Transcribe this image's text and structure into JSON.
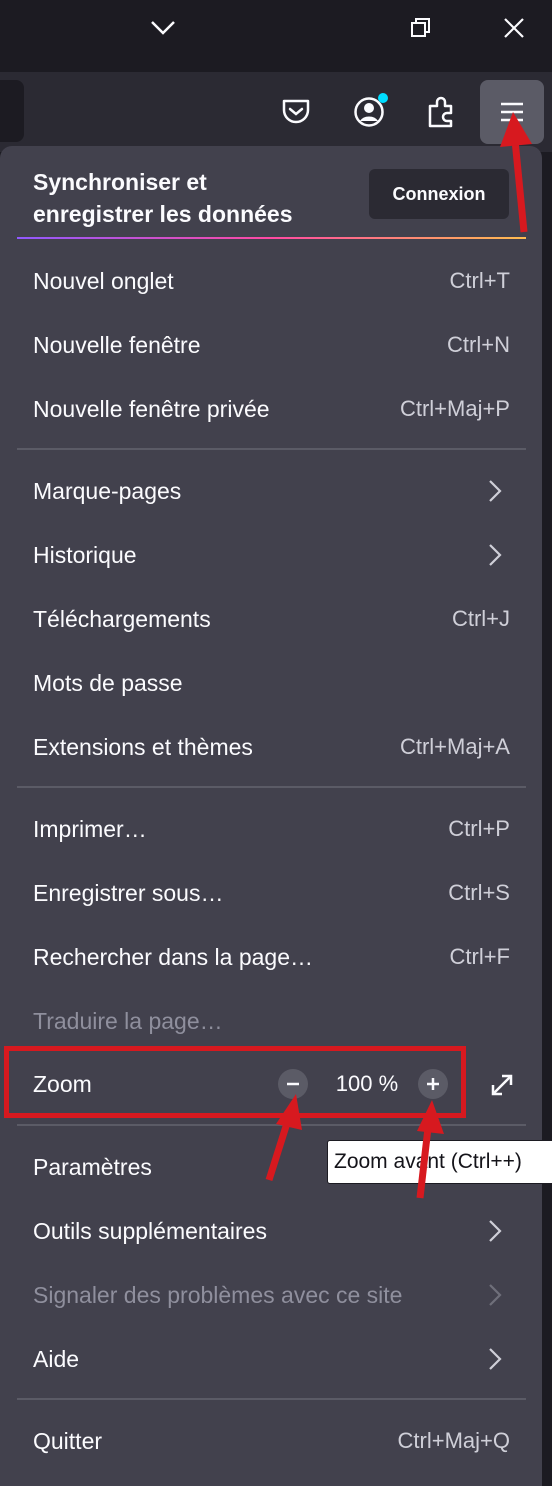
{
  "titlebar": {
    "icons": [
      "chevron-down-icon",
      "restore-icon",
      "close-icon"
    ]
  },
  "toolbar": {
    "icons": [
      "pocket-icon",
      "account-icon",
      "extensions-icon",
      "hamburger-menu-icon"
    ]
  },
  "panel": {
    "sync_title": "Synchroniser et enregistrer les données",
    "connexion_label": "Connexion",
    "items": [
      {
        "label": "Nouvel onglet",
        "shortcut": "Ctrl+T"
      },
      {
        "label": "Nouvelle fenêtre",
        "shortcut": "Ctrl+N"
      },
      {
        "label": "Nouvelle fenêtre privée",
        "shortcut": "Ctrl+Maj+P"
      },
      {
        "label": "Marque-pages",
        "submenu": true
      },
      {
        "label": "Historique",
        "submenu": true
      },
      {
        "label": "Téléchargements",
        "shortcut": "Ctrl+J"
      },
      {
        "label": "Mots de passe"
      },
      {
        "label": "Extensions et thèmes",
        "shortcut": "Ctrl+Maj+A"
      },
      {
        "label": "Imprimer…",
        "shortcut": "Ctrl+P"
      },
      {
        "label": "Enregistrer sous…",
        "shortcut": "Ctrl+S"
      },
      {
        "label": "Rechercher dans la page…",
        "shortcut": "Ctrl+F"
      },
      {
        "label": "Traduire la page…",
        "disabled": true
      },
      {
        "label": "Paramètres"
      },
      {
        "label": "Outils supplémentaires",
        "submenu": true
      },
      {
        "label": "Signaler des problèmes avec ce site",
        "submenu": true,
        "disabled": true
      },
      {
        "label": "Aide",
        "submenu": true
      },
      {
        "label": "Quitter",
        "shortcut": "Ctrl+Maj+Q"
      }
    ],
    "zoom": {
      "label": "Zoom",
      "value": "100 %"
    }
  },
  "tooltip": "Zoom avant (Ctrl++)",
  "colors": {
    "panel": "#42414d",
    "toolbar": "#2b2a33",
    "annotation": "#d7191f"
  }
}
